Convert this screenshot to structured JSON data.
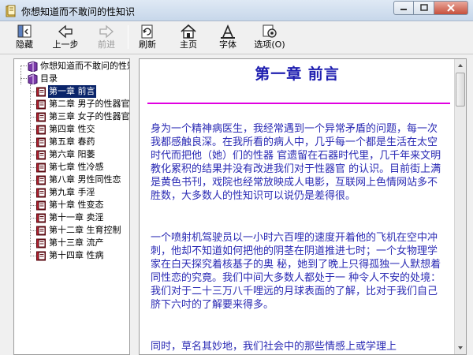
{
  "window": {
    "title": "你想知道而不敢问的性知识"
  },
  "toolbar": {
    "hide": "隐藏",
    "back": "上一步",
    "forward": "前进",
    "refresh": "刷新",
    "home": "主页",
    "font": "字体",
    "options": "选项(O)"
  },
  "tree": {
    "items": [
      {
        "label": "你想知道而不敢问的性知识",
        "icon": "book-purple-icon"
      },
      {
        "label": "目录",
        "icon": "book-purple-icon"
      },
      {
        "label": "第一章  前言",
        "icon": "book-open-icon",
        "selected": true
      },
      {
        "label": "第二章  男子的性器官",
        "icon": "book-open-icon"
      },
      {
        "label": "第三章  女子的性器官",
        "icon": "book-open-icon"
      },
      {
        "label": "第四章  性交",
        "icon": "book-open-icon"
      },
      {
        "label": "第五章  春药",
        "icon": "book-open-icon"
      },
      {
        "label": "第六章  阳萎",
        "icon": "book-open-icon"
      },
      {
        "label": "第七章  性冷感",
        "icon": "book-open-icon"
      },
      {
        "label": "第八章  男性同性恋",
        "icon": "book-open-icon"
      },
      {
        "label": "第九章  手淫",
        "icon": "book-open-icon"
      },
      {
        "label": "第十章  性变态",
        "icon": "book-open-icon"
      },
      {
        "label": "第十一章  卖淫",
        "icon": "book-open-icon"
      },
      {
        "label": "第十二章  生育控制",
        "icon": "book-open-icon"
      },
      {
        "label": "第十三章  流产",
        "icon": "book-open-icon"
      },
      {
        "label": "第十四章  性病",
        "icon": "book-open-icon"
      }
    ]
  },
  "content": {
    "chapter_title": "第一章  前言",
    "paragraphs": [
      "身为一个精神病医生，我经常遇到一个异常矛盾的问题，每一次我都感触良深。在我所看的病人中，几乎每一个都是生活在太空时代而把他（她）们的性器 官遗留在石器时代里，几千年来文明教化累积的结果并没有改进我们对于性器官 的认识。目前街上满是黄色书刊，戏院也经常放映成人电影，互联网上色情网站多不胜数，大多数人的性知识可以说仍是差得很。",
      "一个喷射机驾驶员以一小时六百哩的速度开着他的飞机在空中冲刺，他却不知道如何把他的阴茎在阴道推进七时；一个女物理学家在白天探究着核基子的奥 秘，她到了晚上只得孤独一人默想着同性恋的究竟。我们中间大多数人都处于一 种令人不安的处境：我们对于二十三万八千哩远的月球表面的了解，比对于我们自己脐下六吋的了解要来得多。",
      "同时，草名其妙地，我们社会中的那些情感上或学理上"
    ]
  },
  "colors": {
    "content_text": "#2a2ab4",
    "chapter_title": "#1f1fb0",
    "divider": "#e000e0",
    "selection": "#0a246a"
  }
}
